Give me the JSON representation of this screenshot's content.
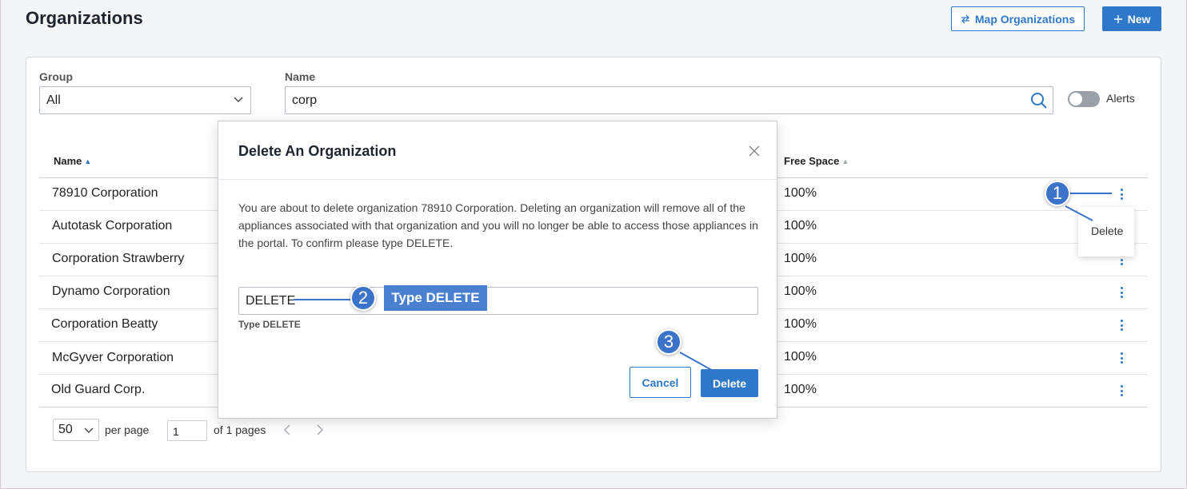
{
  "header": {
    "title": "Organizations",
    "map_label": "Map Organizations",
    "new_label": "New"
  },
  "filters": {
    "group_label": "Group",
    "group_value": "All",
    "name_label": "Name",
    "name_value": "corp",
    "alerts_label": "Alerts"
  },
  "table": {
    "col_name": "Name",
    "col_free": "Free Space",
    "rows": [
      {
        "name": "78910 Corporation",
        "free": "100%"
      },
      {
        "name": "Autotask Corporation",
        "free": "100%"
      },
      {
        "name": "Corporation Strawberry",
        "free": "100%"
      },
      {
        "name": "Dynamo Corporation",
        "free": "100%"
      },
      {
        "name": "Corporation Beatty",
        "free": "100%"
      },
      {
        "name": "McGyver Corporation",
        "free": "100%"
      },
      {
        "name": "Old Guard Corp.",
        "free": "100%"
      }
    ]
  },
  "row_menu": {
    "delete_label": "Delete"
  },
  "pager": {
    "per_page_value": "50",
    "per_page_label": "per page",
    "page_value": "1",
    "of_pages": "of 1 pages"
  },
  "modal": {
    "title": "Delete An Organization",
    "body": "You are about to delete organization 78910 Corporation. Deleting an organization will remove all of the appliances associated with that organization and you will no longer be able to access those appliances in the portal. To confirm please type DELETE.",
    "input_value": "DELETE",
    "helper": "Type DELETE",
    "cancel_label": "Cancel",
    "delete_label": "Delete"
  },
  "annotations": {
    "step1": "1",
    "step2": "2",
    "step3": "3",
    "tag": "Type DELETE"
  },
  "colors": {
    "accent": "#2d78c8",
    "callout": "#3a73c9"
  }
}
